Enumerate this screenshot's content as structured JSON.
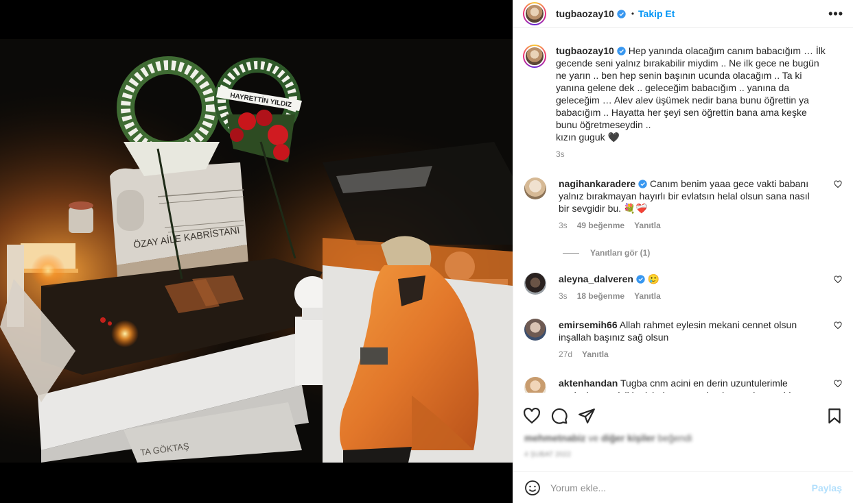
{
  "post": {
    "username": "tugbaozay10",
    "dot": "•",
    "follow_label": "Takip Et",
    "more_icon": "more-horizontal-icon",
    "caption_text": "Hep yanında olacağım canım babacığım … İlk gecende seni yalnız bırakabilir miydim .. Ne ilk gece ne bugün ne yarın .. ben hep senin başının ucunda olacağım .. Ta ki yanına gelene dek .. geleceğim babacığım .. yanına da geleceğim … Alev alev üşümek nedir bana bunu öğrettin ya babacığım .. Hayatta her şeyi sen öğrettin bana ama keşke bunu öğretmeseydin ..",
    "caption_signoff": "kızın guguk 🖤",
    "caption_time": "3s"
  },
  "photo": {
    "sign": "HAYRETTİN YILDIZ",
    "grave_title": "ÖZAY AİLE KABRİSTANI",
    "footer_text": "TA GÖKTAŞ"
  },
  "comments": [
    {
      "username": "nagihankaradere",
      "verified": true,
      "text": "Canım benim yaaa gece vakti babanı yalnız bırakmayan hayırlı bir evlatsın helal olsun sana nasıl bir sevgidir bu. 💐❤️‍🩹",
      "time": "3s",
      "likes": "49 beğenme",
      "reply": "Yanıtla",
      "view_replies": "Yanıtları gör (1)"
    },
    {
      "username": "aleyna_dalveren",
      "verified": true,
      "text": "🥲",
      "time": "3s",
      "likes": "18 beğenme",
      "reply": "Yanıtla"
    },
    {
      "username": "emirsemih66",
      "verified": false,
      "text": "Allah rahmet eylesin mekani cennet olsun inşallah başınız sağ olsun",
      "time": "27d",
      "reply": "Yanıtla"
    },
    {
      "username": "aktenhandan",
      "verified": false,
      "text": "Tugba cnm acini en derin uzuntulerimle paylasiyorum isiklar icinde uyusun basin sagolsun sabir"
    }
  ],
  "likes_line": {
    "user": "mehmetnabiz",
    "connector": "ve",
    "others": "diğer kişiler",
    "suffix": "beğendi"
  },
  "date_line": "4 ŞUBAT 2022",
  "add_comment": {
    "placeholder": "Yorum ekle...",
    "post_label": "Paylaş"
  },
  "colors": {
    "accent": "#0095f6",
    "verified": "#3897f0",
    "post_disabled": "#b2dffc",
    "muted": "#8e8e8e",
    "text": "#262626"
  }
}
